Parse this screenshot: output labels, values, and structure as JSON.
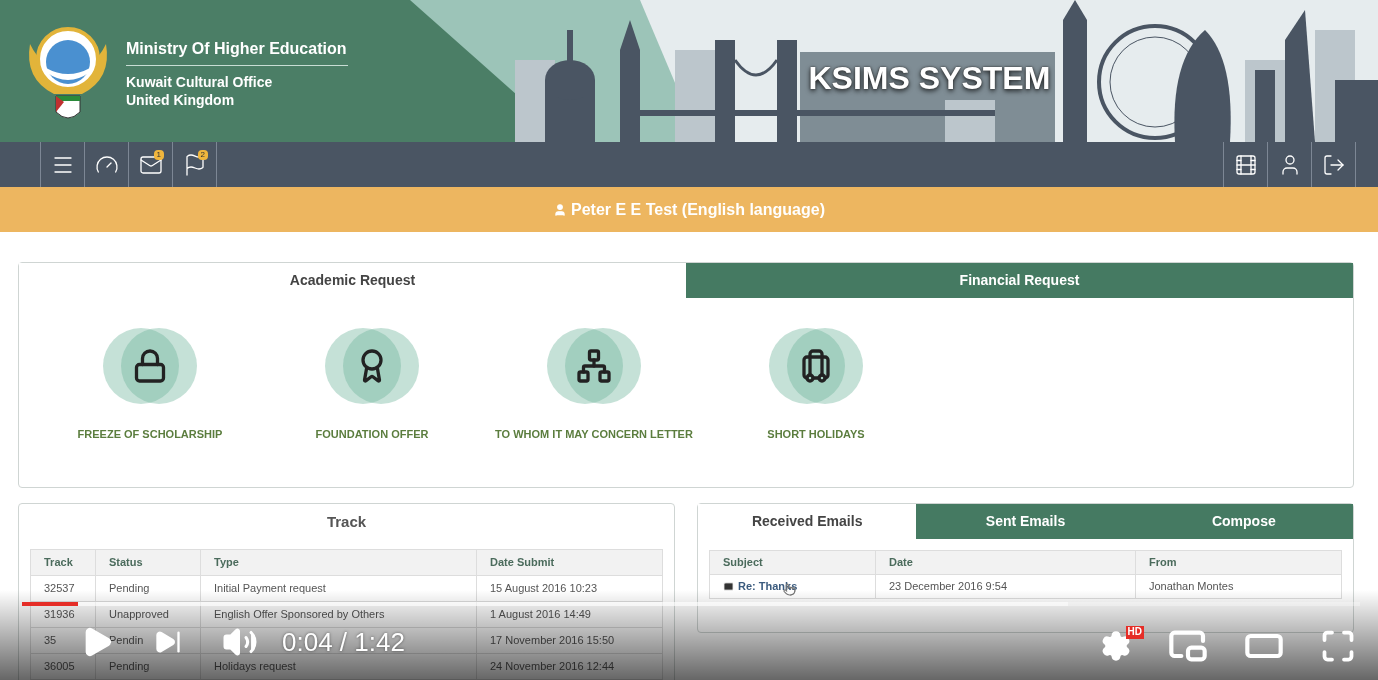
{
  "header": {
    "ministry": "Ministry Of Higher Education",
    "office_line1": "Kuwait Cultural Office",
    "office_line2": "United Kingdom",
    "system_title": "KSIMS SYSTEM"
  },
  "navbar": {
    "left_items": [
      {
        "kind": "menu"
      },
      {
        "kind": "dashboard"
      },
      {
        "kind": "mail",
        "badge": "1"
      },
      {
        "kind": "flag",
        "badge": "2"
      }
    ],
    "right_items": [
      {
        "kind": "film"
      },
      {
        "kind": "user"
      },
      {
        "kind": "logout"
      }
    ]
  },
  "user_bar": {
    "name": "Peter E E Test (English language)"
  },
  "request_tabs": [
    {
      "label": "Academic Request",
      "selected": true
    },
    {
      "label": "Financial Request",
      "selected": false
    }
  ],
  "services": [
    {
      "kind": "lock",
      "label": "FREEZE OF SCHOLARSHIP"
    },
    {
      "kind": "certificate",
      "label": "FOUNDATION OFFER"
    },
    {
      "kind": "hierarchy",
      "label": "TO WHOM IT MAY CONCERN LETTER"
    },
    {
      "kind": "luggage",
      "label": "SHORT HOLIDAYS"
    }
  ],
  "track": {
    "title": "Track",
    "columns": [
      "Track",
      "Status",
      "Type",
      "Date Submit"
    ],
    "rows": [
      {
        "track": "32537",
        "status": "Pending",
        "type": "Initial Payment request",
        "date": "15 August 2016 10:23"
      },
      {
        "track": "31936",
        "status": "Unapproved",
        "type": "English Offer Sponsored by Others",
        "date": "1 August 2016 14:49"
      },
      {
        "track": "35",
        "status": "Pendin",
        "date": "17 November 2016 15:50"
      },
      {
        "track": "36005",
        "status": "Pending",
        "type": "Holidays request",
        "date": "24 November 2016 12:44"
      }
    ]
  },
  "emails": {
    "tabs": [
      {
        "label": "Received Emails",
        "selected": true
      },
      {
        "label": "Sent Emails",
        "selected": false
      },
      {
        "label": "Compose",
        "selected": false
      }
    ],
    "columns": [
      "Subject",
      "Date",
      "From"
    ],
    "rows": [
      {
        "subject": "Re: Thanks",
        "date": "23 December 2016 9:54",
        "from": "Jonathan Montes"
      }
    ]
  },
  "player": {
    "time": "0:04 / 1:42",
    "quality_badge": "HD",
    "progress": {
      "level": 0.042
    },
    "buffer": {
      "level": 0.782
    }
  }
}
